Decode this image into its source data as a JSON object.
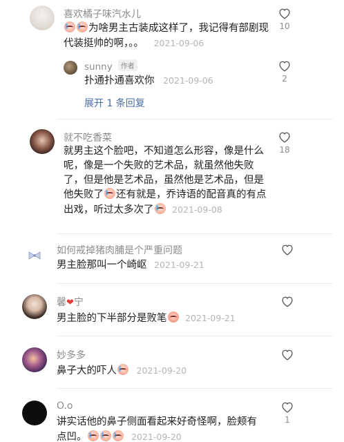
{
  "comments": [
    {
      "username": "喜欢橘子味汽水儿",
      "text": "为啥男主古装成这样了，我记得有部剧现代装挺帅的啊，。。",
      "line1": "为啥男主古装成这样了，我记得有部剧现",
      "line2": "代装挺帅的啊，。。",
      "time": "2021-09-06",
      "likes": "10",
      "reply": {
        "username": "sunny",
        "tag": "作者",
        "text": "扑通扑通喜欢你",
        "time": "2021-09-06",
        "likes": "2"
      },
      "expand_label": "展开 1 条回复"
    },
    {
      "username": "就不吃香菜",
      "lines": [
        "就男主这个脸吧，不知道怎么形容，像是什么",
        "呢，像是一个失败的艺术品，就虽然他失败",
        "了，但是他是艺术品，虽然他是艺术品，但是",
        "他失败了",
        "还有就是，乔诗语的配音真的有点",
        "出戏，听过太多次了"
      ],
      "time": "2021-09-08",
      "likes": "18"
    },
    {
      "username": "如何戒掉猪肉脯是个严重问题",
      "text": "男主脸那叫一个崎岖",
      "time": "2021-09-21",
      "likes": ""
    },
    {
      "username_pre": "馨",
      "username_post": "宁",
      "text": "男主脸的下半部分是败笔",
      "time": "2021-09-21",
      "likes": ""
    },
    {
      "username": "妙多多",
      "text": "鼻子大的吓人",
      "time": "2021-09-20",
      "likes": ""
    },
    {
      "username": "O.o",
      "line1": "讲实话他的鼻子侧面看起来好奇怪啊，脸颊有",
      "line2": "点凹。",
      "time": "2021-09-20",
      "likes": "1"
    }
  ],
  "icons": {
    "like": "heart-outline-icon",
    "emoji": "crying-laughing-emoji-icon",
    "heart": "red-heart-emoji"
  },
  "colors": {
    "username": "#8c8c8c",
    "time": "#b5b5b5",
    "expand": "#4a6ea8"
  }
}
